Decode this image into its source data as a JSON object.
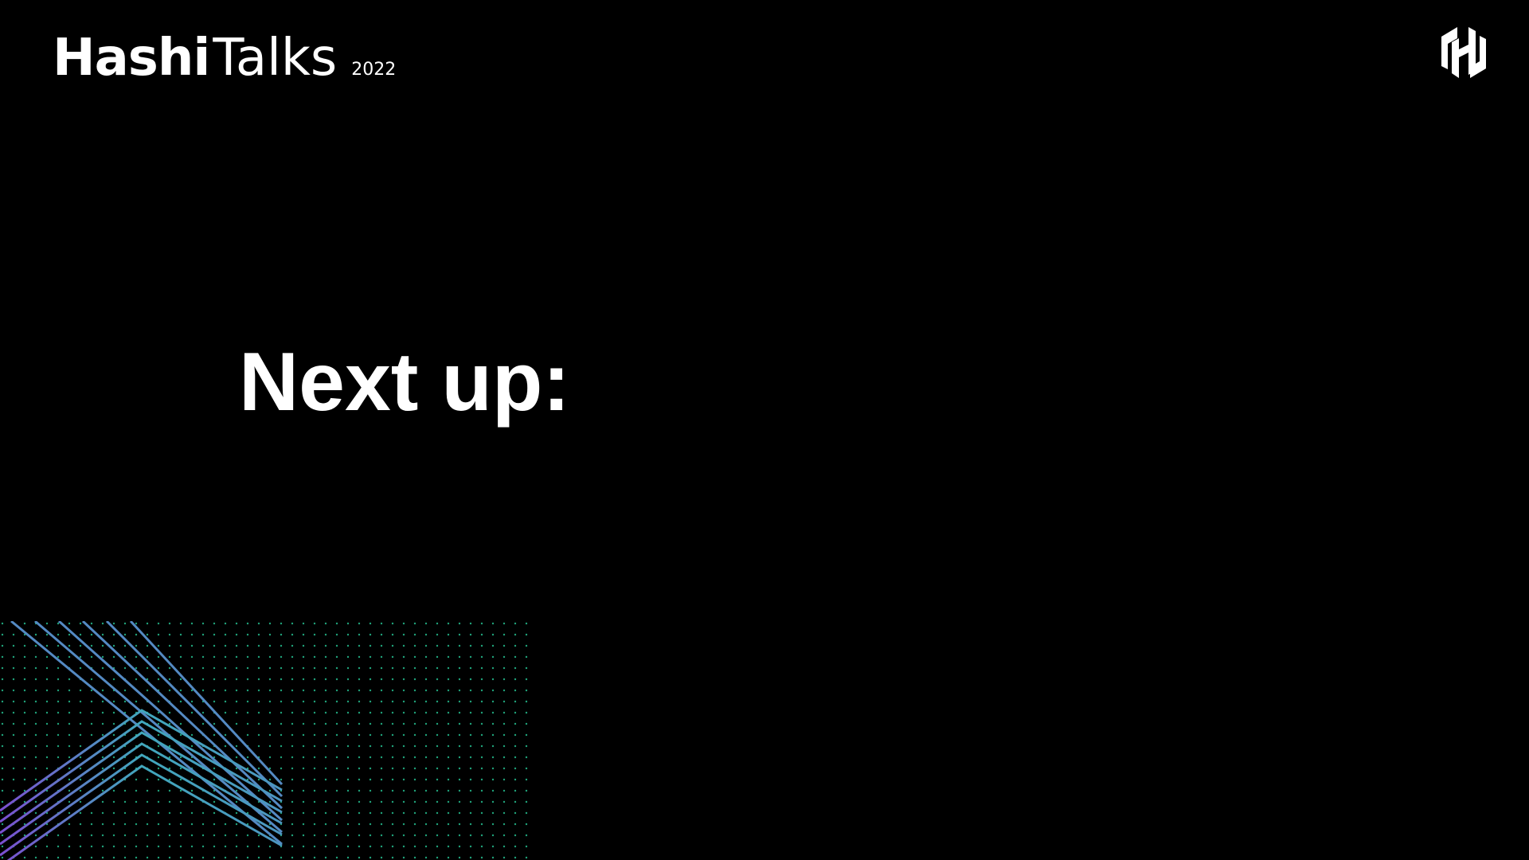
{
  "header": {
    "brand_bold": "Hashi",
    "brand_light": "Talks",
    "year": "2022",
    "logo_icon": "hashicorp-logo-icon"
  },
  "main": {
    "headline": "Next up:"
  },
  "decoration": {
    "icon": "chevron-lines-pattern",
    "colors": {
      "purple": "#7b4fd0",
      "teal": "#2ec4b6",
      "dots": "#1fa37a"
    }
  }
}
